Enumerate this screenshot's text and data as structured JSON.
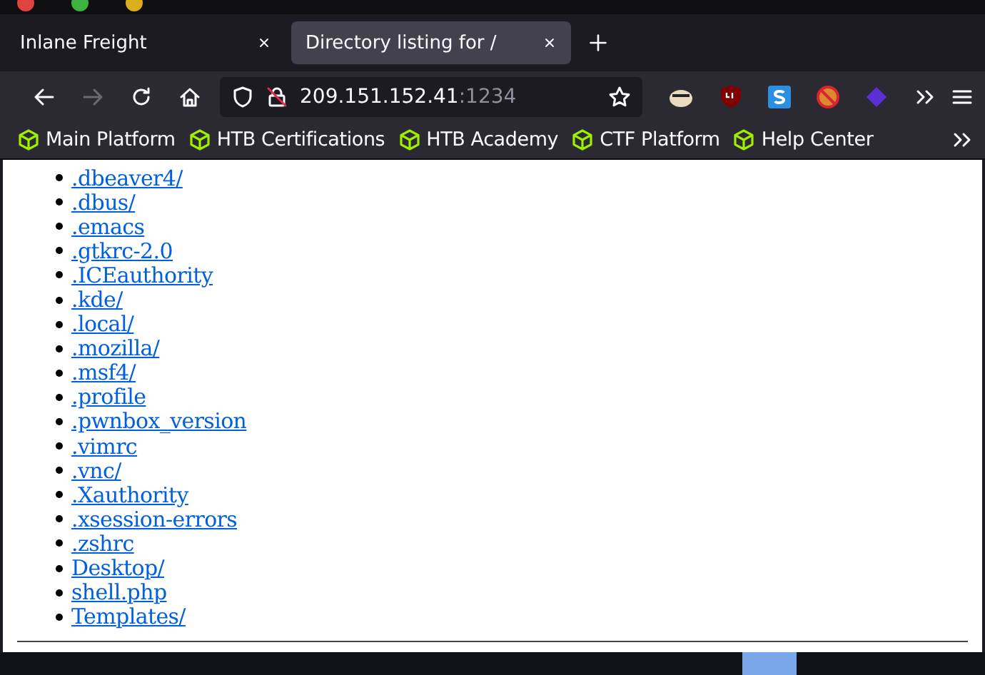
{
  "tabs": [
    {
      "label": "Inlane Freight",
      "selected": false
    },
    {
      "label": "Directory listing for /",
      "selected": true
    }
  ],
  "nav_buttons": [
    {
      "kind": "back",
      "disabled": false
    },
    {
      "kind": "forward",
      "disabled": true
    },
    {
      "kind": "reload",
      "disabled": false
    },
    {
      "kind": "home",
      "disabled": false
    }
  ],
  "url": {
    "host": "209.151.152.41",
    "port": ":1234"
  },
  "bookmarks": [
    "Main Platform",
    "HTB Certifications",
    "HTB Academy",
    "CTF Platform",
    "Help Center"
  ],
  "listing": [
    ".dbeaver4/",
    ".dbus/",
    ".emacs",
    ".gtkrc-2.0",
    ".ICEauthority",
    ".kde/",
    ".local/",
    ".mozilla/",
    ".msf4/",
    ".profile",
    ".pwnbox_version",
    ".vimrc",
    ".vnc/",
    ".Xauthority",
    ".xsession-errors",
    ".zshrc",
    "Desktop/",
    "shell.php",
    "Templates/"
  ]
}
